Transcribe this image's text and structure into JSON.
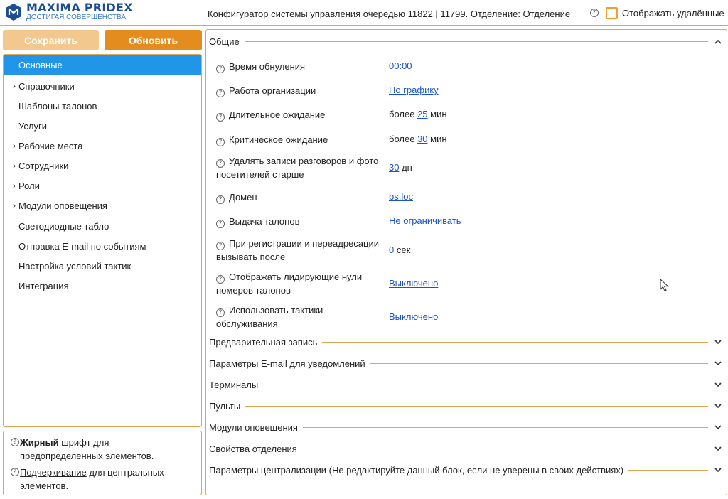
{
  "header": {
    "logo_title": "MAXIMA PRIDEX",
    "logo_subtitle": "ДОСТИГАЯ СОВЕРШЕНСТВА",
    "title": "Конфигуратор системы управления очередью 11822 | 11799. Отделение: Отделение",
    "show_deleted_label": "Отображать удалённые",
    "show_deleted_checked": false,
    "accent_color": "#f0a030"
  },
  "toolbar": {
    "save_label": "Сохранить",
    "refresh_label": "Обновить"
  },
  "sidebar": {
    "items": [
      {
        "label": "Основные",
        "expandable": false,
        "active": true
      },
      {
        "label": "Справочники",
        "expandable": true,
        "active": false
      },
      {
        "label": "Шаблоны талонов",
        "expandable": false,
        "active": false
      },
      {
        "label": "Услуги",
        "expandable": false,
        "active": false
      },
      {
        "label": "Рабочие места",
        "expandable": true,
        "active": false
      },
      {
        "label": "Сотрудники",
        "expandable": true,
        "active": false
      },
      {
        "label": "Роли",
        "expandable": true,
        "active": false
      },
      {
        "label": "Модули оповещения",
        "expandable": true,
        "active": false
      },
      {
        "label": "Светодиодные табло",
        "expandable": false,
        "active": false
      },
      {
        "label": "Отправка E-mail по событиям",
        "expandable": false,
        "active": false
      },
      {
        "label": "Настройка условий тактик",
        "expandable": false,
        "active": false
      },
      {
        "label": "Интеграция",
        "expandable": false,
        "active": false
      }
    ],
    "legend": {
      "bold_word": "Жирный",
      "bold_rest": " шрифт для предопределенных элементов.",
      "underline_word": "Подчеркивание",
      "underline_rest": " для центральных элементов."
    }
  },
  "main": {
    "general_section": "Общие",
    "properties": [
      {
        "label": "Время обнуления",
        "prefix": "",
        "value": "00:00",
        "suffix": ""
      },
      {
        "label": "Работа организации",
        "prefix": "",
        "value": "По графику",
        "suffix": ""
      },
      {
        "label": "Длительное ожидание",
        "prefix": "более ",
        "value": "25",
        "suffix": " мин"
      },
      {
        "label": "Критическое ожидание",
        "prefix": "более ",
        "value": "30",
        "suffix": " мин"
      },
      {
        "label": "Удалять записи разговоров и фото посетителей старше",
        "prefix": "",
        "value": "30",
        "suffix": " дн"
      },
      {
        "label": "Домен",
        "prefix": "",
        "value": "bs.loc",
        "suffix": ""
      },
      {
        "label": "Выдача талонов",
        "prefix": "",
        "value": "Не ограничивать",
        "suffix": ""
      },
      {
        "label": "При регистрации и переадресации вызывать после",
        "prefix": "",
        "value": "0",
        "suffix": " сек"
      },
      {
        "label": "Отображать лидирующие нули номеров талонов",
        "prefix": "",
        "value": "Выключено",
        "suffix": ""
      },
      {
        "label": "Использовать тактики обслуживания",
        "prefix": "",
        "value": "Выключено",
        "suffix": ""
      }
    ],
    "collapsed_sections": [
      "Предварительная запись",
      "Параметры E-mail для уведомлений",
      "Терминалы",
      "Пульты",
      "Модули оповещения",
      "Свойства отделения",
      "Параметры централизации (Не редактируйте данный блок, если не уверены в своих действиях)"
    ]
  }
}
